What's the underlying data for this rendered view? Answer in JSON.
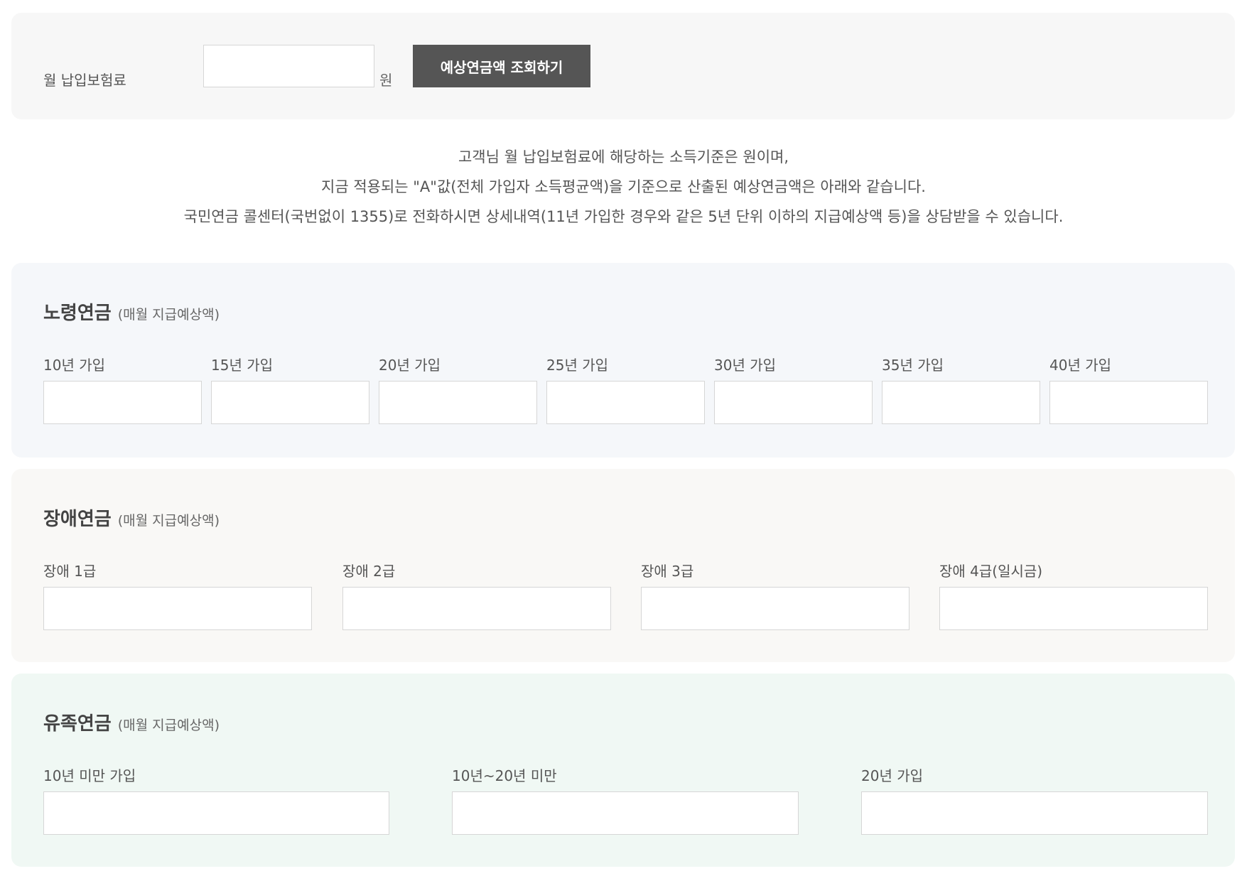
{
  "query": {
    "label": "월 납입보험료",
    "input_value": "",
    "unit": "원",
    "button_label": "예상연금액 조회하기"
  },
  "notice": {
    "line1": "고객님 월 납입보험료에 해당하는 소득기준은 원이며,",
    "line2": "지금 적용되는 \"A\"값(전체 가입자 소득평균액)을 기준으로 산출된 예상연금액은 아래와 같습니다.",
    "line3": "국민연금 콜센터(국번없이 1355)로 전화하시면 상세내역(11년 가입한 경우와 같은 5년 단위 이하의 지급예상액 등)을 상담받을 수 있습니다."
  },
  "old_age": {
    "title": "노령연금",
    "subtitle": "(매월 지급예상액)",
    "fields": [
      {
        "label": "10년 가입",
        "value": ""
      },
      {
        "label": "15년 가입",
        "value": ""
      },
      {
        "label": "20년 가입",
        "value": ""
      },
      {
        "label": "25년 가입",
        "value": ""
      },
      {
        "label": "30년 가입",
        "value": ""
      },
      {
        "label": "35년 가입",
        "value": ""
      },
      {
        "label": "40년 가입",
        "value": ""
      }
    ]
  },
  "disability": {
    "title": "장애연금",
    "subtitle": "(매월 지급예상액)",
    "fields": [
      {
        "label": "장애 1급",
        "value": ""
      },
      {
        "label": "장애 2급",
        "value": ""
      },
      {
        "label": "장애 3급",
        "value": ""
      },
      {
        "label": "장애 4급(일시금)",
        "value": ""
      }
    ]
  },
  "survivor": {
    "title": "유족연금",
    "subtitle": "(매월 지급예상액)",
    "fields": [
      {
        "label": "10년 미만 가입",
        "value": ""
      },
      {
        "label": "10년~20년 미만",
        "value": ""
      },
      {
        "label": "20년 가입",
        "value": ""
      }
    ]
  }
}
